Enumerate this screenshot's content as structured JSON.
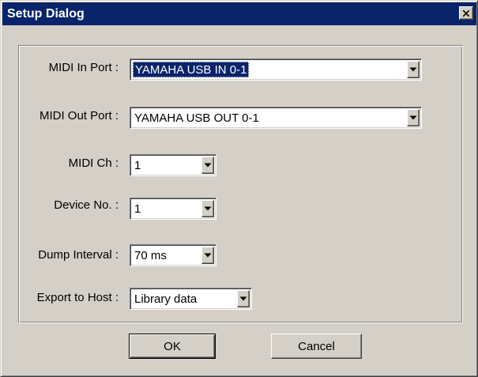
{
  "window": {
    "title": "Setup Dialog"
  },
  "fields": {
    "midi_in_port": {
      "label": "MIDI In Port :",
      "value": "YAMAHA USB IN 0-1"
    },
    "midi_out_port": {
      "label": "MIDI Out Port :",
      "value": "YAMAHA USB OUT 0-1"
    },
    "midi_ch": {
      "label": "MIDI Ch :",
      "value": "1"
    },
    "device_no": {
      "label": "Device No. :",
      "value": "1"
    },
    "dump_interval": {
      "label": "Dump Interval :",
      "value": "70 ms"
    },
    "export_to_host": {
      "label": "Export to Host :",
      "value": "Library data"
    }
  },
  "buttons": {
    "ok": "OK",
    "cancel": "Cancel"
  },
  "icons": {
    "close": "close-icon",
    "dropdown": "chevron-down-icon"
  },
  "colors": {
    "titlebar": "#0a246a",
    "face": "#d4d0c8",
    "selection": "#0a246a"
  }
}
